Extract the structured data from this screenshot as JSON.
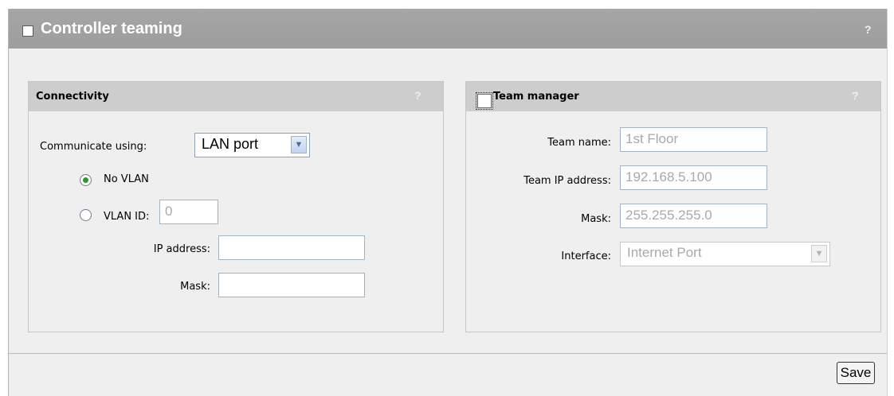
{
  "header": {
    "title": "Controller teaming",
    "help": "?"
  },
  "connectivity": {
    "title": "Connectivity",
    "help": "?",
    "communicate_label": "Communicate using:",
    "communicate_value": "LAN port",
    "no_vlan_label": "No VLAN",
    "vlan_id_label": "VLAN ID:",
    "vlan_id_value": "0",
    "ip_address_label": "IP address:",
    "ip_address_value": "",
    "mask_label": "Mask:",
    "mask_value": "",
    "selected_option": "No VLAN"
  },
  "team_manager": {
    "title": "Team manager",
    "help": "?",
    "team_name_label": "Team name:",
    "team_name_value": "1st Floor",
    "team_ip_label": "Team IP address:",
    "team_ip_value": "192.168.5.100",
    "mask_label": "Mask:",
    "mask_value": "255.255.255.0",
    "interface_label": "Interface:",
    "interface_value": "Internet Port"
  },
  "footer": {
    "save_label": "Save"
  },
  "colors": {
    "header_bg": "#a0a0a0",
    "radio_selected": "#2a9a2a"
  }
}
